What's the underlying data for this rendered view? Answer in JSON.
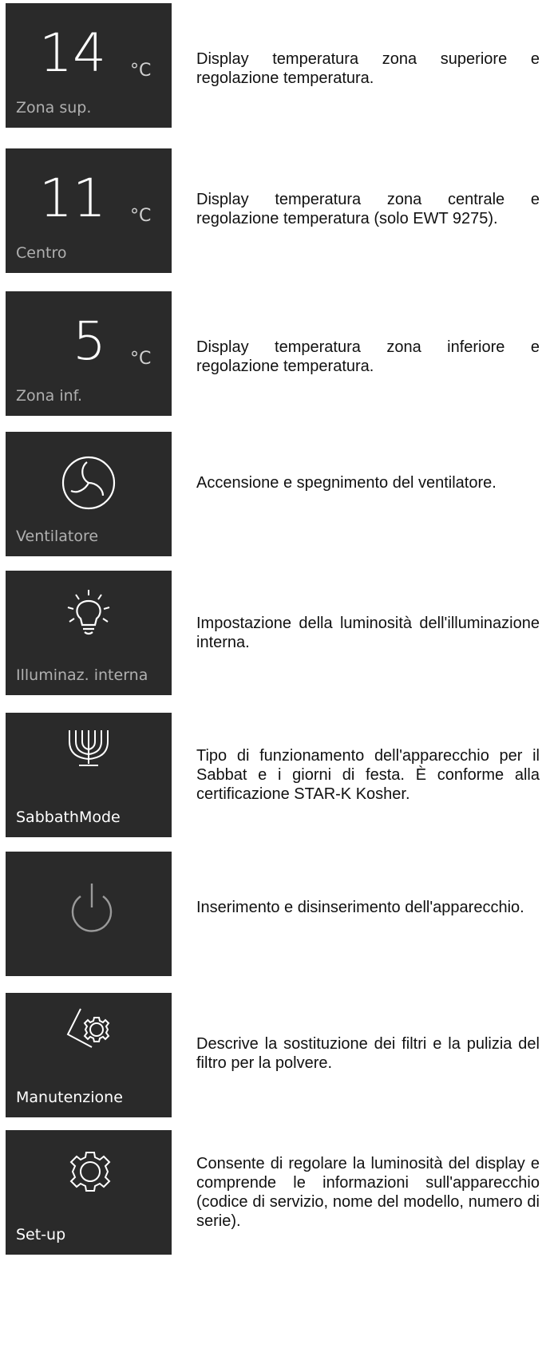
{
  "items": [
    {
      "tile_value": "14",
      "tile_unit": "°C",
      "tile_label": "Zona sup.",
      "description": "Display temperatura zona superiore e regolazione temperatura."
    },
    {
      "tile_value": "11",
      "tile_unit": "°C",
      "tile_label": "Centro",
      "description": "Display temperatura zona centrale e regolazione temperatura (solo EWT 9275)."
    },
    {
      "tile_value": "5",
      "tile_unit": "°C",
      "tile_label": "Zona inf.",
      "description": "Display temperatura zona inferiore e regolazione temperatura."
    },
    {
      "icon": "fan-icon",
      "tile_label": "Ventilatore",
      "description": "Accensione e spegnimento del ventilatore."
    },
    {
      "icon": "light-bulb-icon",
      "tile_label": "Illuminaz. interna",
      "description": "Impostazione della luminosità dell'illuminazione interna."
    },
    {
      "icon": "menorah-icon",
      "tile_label": "SabbathMode",
      "description": "Tipo di funzionamento dell'apparecchio per il Sabbat e i giorni di festa. È conforme alla certificazione STAR-K Kosher."
    },
    {
      "icon": "power-icon",
      "description": "Inserimento e disinserimento dell'apparecchio."
    },
    {
      "icon": "maintenance-gear-icon",
      "tile_label": "Manutenzione",
      "description": "Descrive la sostituzione dei filtri e la pulizia del filtro per la polvere."
    },
    {
      "icon": "setup-gear-icon",
      "tile_label": "Set-up",
      "description": "Consente di regolare la luminosità del display e comprende le informazioni sull'apparecchio (codice di servizio, nome del modello, numero di serie)."
    }
  ]
}
